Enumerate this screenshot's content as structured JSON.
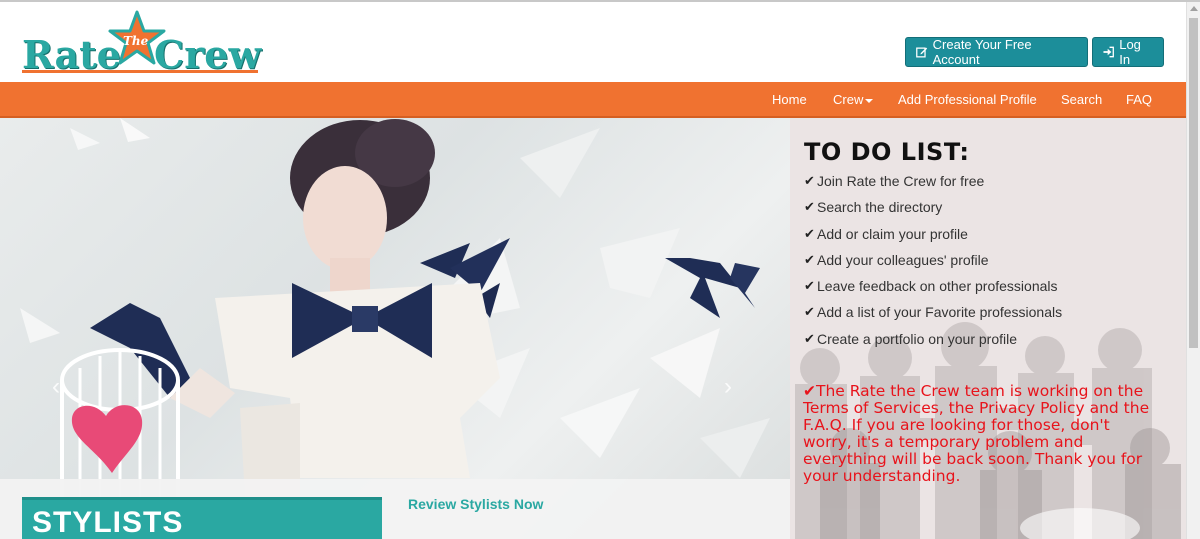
{
  "header": {
    "logo": {
      "word1": "Rate",
      "word2": "Crew",
      "middle": "The"
    },
    "create_account_label": "Create Your Free Account",
    "login_label": "Log In"
  },
  "nav": {
    "items": [
      {
        "label": "Home"
      },
      {
        "label": "Crew"
      },
      {
        "label": "Add Professional Profile"
      },
      {
        "label": "Search"
      },
      {
        "label": "FAQ"
      }
    ]
  },
  "hero": {
    "prev_arrow": "‹",
    "next_arrow": "›"
  },
  "stylists": {
    "title": "STYLISTS",
    "review_link": "Review Stylists Now"
  },
  "todo": {
    "title": "TO DO LIST:",
    "check": "✔",
    "items": [
      "Join Rate the Crew for free",
      "Search the directory",
      "Add or claim your profile",
      "Add your colleagues' profile",
      "Leave feedback on other professionals",
      "Add a list of your Favorite professionals",
      "Create a portfolio on your profile"
    ],
    "notice": "The Rate the Crew team is working on the Terms of Services, the Privacy Policy and the F.A.Q. If you are looking for those, don't worry, it's a temporary problem and everything will be back soon. Thank you for your understanding."
  },
  "colors": {
    "teal": "#2aa8a2",
    "orange": "#f07230",
    "button": "#1c8e9a",
    "notice_red": "#e8131b"
  },
  "icons": {
    "create_account": "edit-icon",
    "login": "sign-in-icon",
    "logo_star": "star-icon"
  }
}
